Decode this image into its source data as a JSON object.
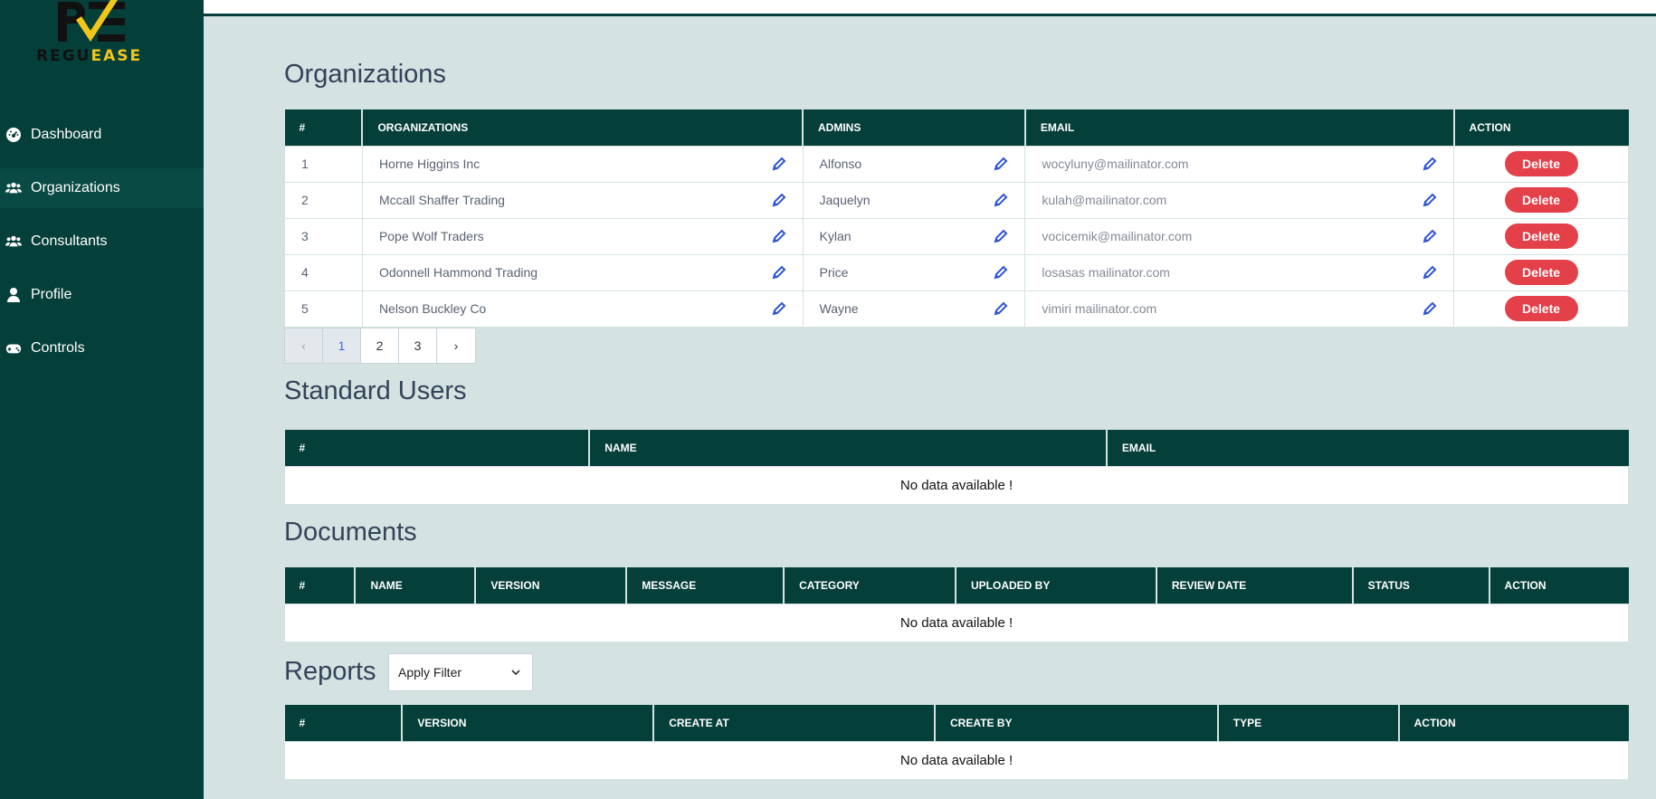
{
  "brand": {
    "text_part1": "REGU",
    "text_part2": "EASE"
  },
  "colors": {
    "primary": "#053f3a",
    "background": "#d4e2e1",
    "delete": "#e4404a",
    "edit_icon": "#2f55d4",
    "logo_yellow": "#f2c619"
  },
  "sidebar": {
    "items": [
      {
        "label": "Dashboard",
        "icon": "dashboard-icon"
      },
      {
        "label": "Organizations",
        "icon": "users-icon"
      },
      {
        "label": "Consultants",
        "icon": "users-icon"
      },
      {
        "label": "Profile",
        "icon": "user-icon"
      },
      {
        "label": "Controls",
        "icon": "gamepad-icon"
      }
    ],
    "active": "Organizations"
  },
  "organizations": {
    "title": "Organizations",
    "columns": [
      "#",
      "ORGANIZATIONS",
      "ADMINS",
      "EMAIL",
      "ACTION"
    ],
    "rows": [
      {
        "num": "1",
        "org": "Horne Higgins Inc",
        "admin": "Alfonso",
        "email": "wocyluny@mailinator.com",
        "action": "Delete"
      },
      {
        "num": "2",
        "org": "Mccall Shaffer Trading",
        "admin": "Jaquelyn",
        "email": "kulah@mailinator.com",
        "action": "Delete"
      },
      {
        "num": "3",
        "org": "Pope Wolf Traders",
        "admin": "Kylan",
        "email": "vocicemik@mailinator.com",
        "action": "Delete"
      },
      {
        "num": "4",
        "org": "Odonnell Hammond Trading",
        "admin": "Price",
        "email": "losasas mailinator.com",
        "action": "Delete"
      },
      {
        "num": "5",
        "org": "Nelson Buckley Co",
        "admin": "Wayne",
        "email": "vimiri mailinator.com",
        "action": "Delete"
      }
    ],
    "pagination": {
      "prev": "‹",
      "pages": [
        "1",
        "2",
        "3"
      ],
      "current": "1",
      "next": "›"
    }
  },
  "standard_users": {
    "title": "Standard Users",
    "columns": [
      "#",
      "NAME",
      "EMAIL"
    ],
    "empty": "No data available !"
  },
  "documents": {
    "title": "Documents",
    "columns": [
      "#",
      "NAME",
      "VERSION",
      "MESSAGE",
      "CATEGORY",
      "UPLOADED BY",
      "REVIEW DATE",
      "STATUS",
      "ACTION"
    ],
    "empty": "No data available !"
  },
  "reports": {
    "title": "Reports",
    "filter": {
      "selected": "Apply Filter"
    },
    "columns": [
      "#",
      "VERSION",
      "CREATE AT",
      "CREATE BY",
      "TYPE",
      "ACTION"
    ],
    "empty": "No data available !"
  }
}
